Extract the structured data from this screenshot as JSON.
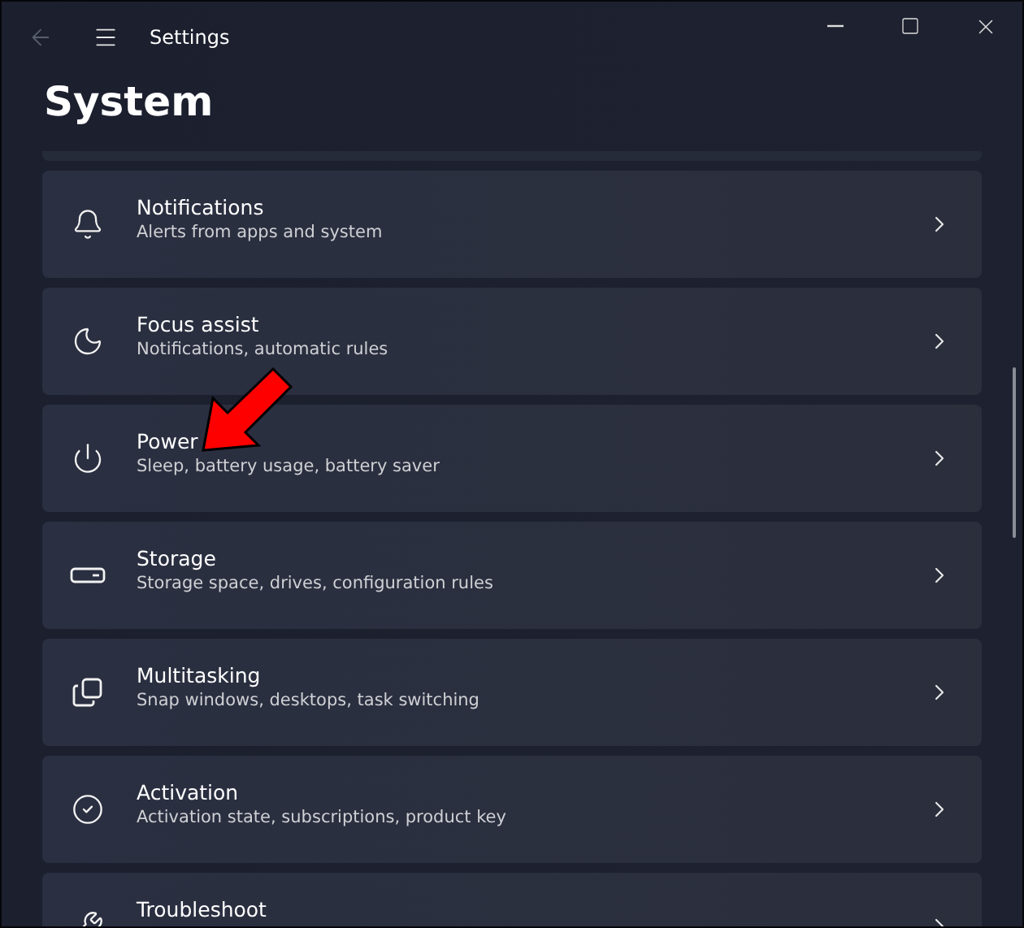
{
  "window": {
    "title": "Settings",
    "back_disabled": true
  },
  "page_title": "System",
  "items": [
    {
      "title": "Notifications",
      "subtitle": "Alerts from apps and system"
    },
    {
      "title": "Focus assist",
      "subtitle": "Notifications, automatic rules"
    },
    {
      "title": "Power",
      "subtitle": "Sleep, battery usage, battery saver"
    },
    {
      "title": "Storage",
      "subtitle": "Storage space, drives, configuration rules"
    },
    {
      "title": "Multitasking",
      "subtitle": "Snap windows, desktops, task switching"
    },
    {
      "title": "Activation",
      "subtitle": "Activation state, subscriptions, product key"
    },
    {
      "title": "Troubleshoot"
    }
  ]
}
